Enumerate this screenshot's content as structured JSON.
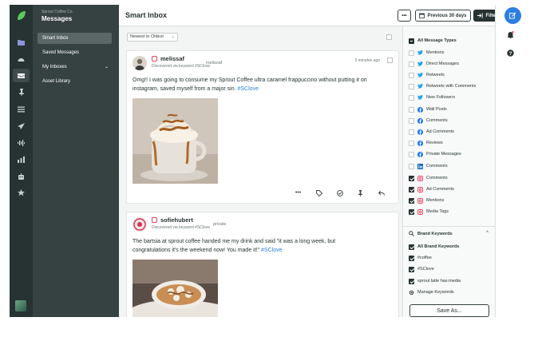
{
  "nav": {
    "brand_sub": "Sprout Coffee Co.",
    "brand_title": "Messages",
    "items": [
      {
        "label": "Smart Inbox",
        "active": true
      },
      {
        "label": "Saved Messages",
        "active": false
      },
      {
        "label": "My Inboxes",
        "active": false,
        "chevron": "⌄"
      },
      {
        "label": "Asset Library",
        "active": false
      }
    ]
  },
  "header": {
    "title": "Smart Inbox",
    "more_label": "•••",
    "date_range_label": "Previous 30 days",
    "filters_label": "Filters"
  },
  "feed": {
    "sort_label": "Newest to Oldest",
    "messages": [
      {
        "name": "melissaf",
        "handle": "melissaf",
        "discovered": "Discovered via keyword #SClove",
        "time": "5 minutes ago",
        "text": "Omg!! I was going to consume my Sprout Coffee ultra caramel frappuccino without putting it on instagram, saved myself from a major sin.",
        "hashtag": "#SClove"
      },
      {
        "name": "sofiehubert",
        "handle": "private",
        "discovered": "Discovered via keyword #SClove",
        "text": "The bartsia at sprout coffee handed me my drink and said \"it was a long week, but congratulations it's the weekend now! You made it!\"",
        "hashtag": "#SClove"
      }
    ]
  },
  "filters": {
    "all_types_label": "All Message Types",
    "types": [
      {
        "label": "Mentions",
        "network": "twitter",
        "checked": false
      },
      {
        "label": "Direct Messages",
        "network": "twitter",
        "checked": false
      },
      {
        "label": "Retweets",
        "network": "twitter",
        "checked": false
      },
      {
        "label": "Retweets with Comments",
        "network": "twitter",
        "checked": false
      },
      {
        "label": "New Followers",
        "network": "twitter",
        "checked": false
      },
      {
        "label": "Wall Posts",
        "network": "facebook",
        "checked": false
      },
      {
        "label": "Comments",
        "network": "facebook",
        "checked": false
      },
      {
        "label": "Ad Comments",
        "network": "facebook",
        "checked": false
      },
      {
        "label": "Reviews",
        "network": "facebook",
        "checked": false
      },
      {
        "label": "Private Messages",
        "network": "facebook",
        "checked": false
      },
      {
        "label": "Comments",
        "network": "linkedin",
        "checked": false
      },
      {
        "label": "Comments",
        "network": "instagram",
        "checked": true
      },
      {
        "label": "Ad Comments",
        "network": "instagram",
        "checked": true
      },
      {
        "label": "Mentions",
        "network": "instagram",
        "checked": true
      },
      {
        "label": "Media Tags",
        "network": "instagram",
        "checked": true
      }
    ],
    "brand_keywords_label": "Brand Keywords",
    "brand_keywords_caret": "^",
    "all_keywords_label": "All Brand Keywords",
    "keywords": [
      {
        "label": "#coffee",
        "checked": true
      },
      {
        "label": "#SClove",
        "checked": true
      },
      {
        "label": "sprout latte has:media",
        "checked": true
      }
    ],
    "manage_label": "Manage Keywords",
    "save_as_label": "Save As..."
  },
  "colors": {
    "rail": "#273333",
    "nav": "#364141",
    "accent_blue": "#2c7fe0",
    "twitter": "#1da1f2",
    "facebook": "#1877f2",
    "linkedin": "#0a66c2",
    "instagram": "#e4405f",
    "logo_green": "#59cb59"
  }
}
